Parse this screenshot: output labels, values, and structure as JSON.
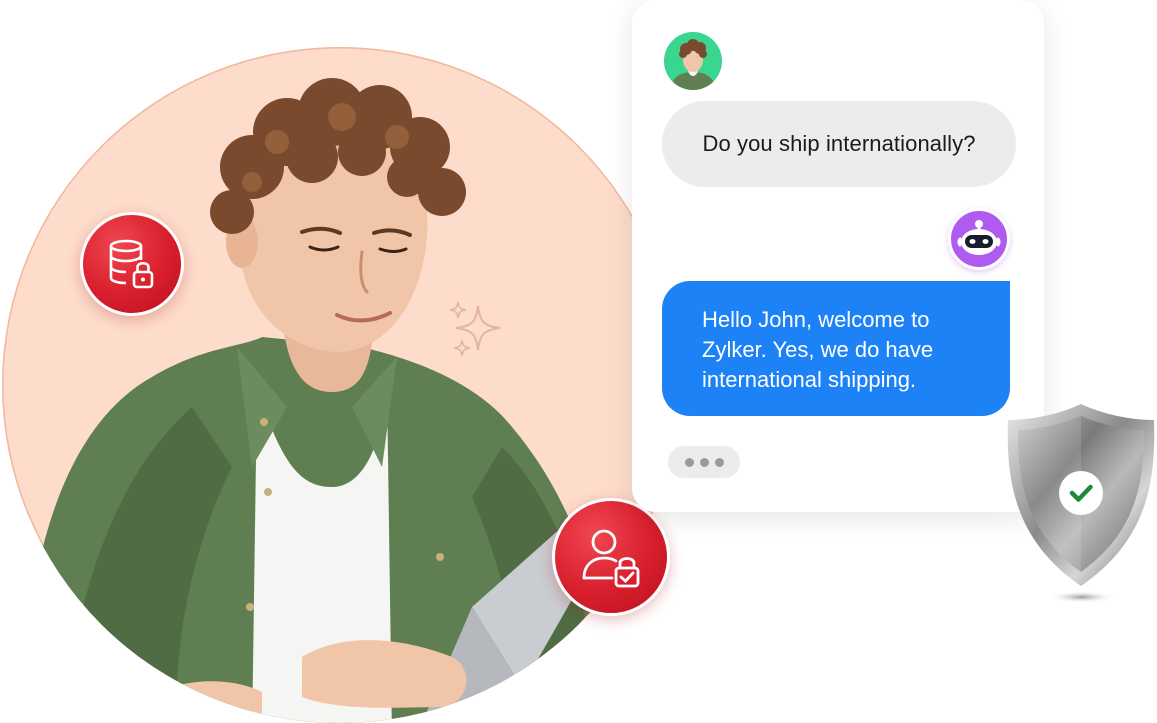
{
  "chat": {
    "user_message": "Do you ship internationally?",
    "bot_message_lines": [
      "Hello John, welcome to",
      "Zylker. Yes, we do have",
      "international shipping."
    ],
    "typing_indicator": "typing-dots"
  },
  "icons": {
    "database_lock": "database-lock-icon",
    "user_lock": "user-lock-icon",
    "shield_check": "shield-check-icon",
    "sparkle": "sparkle-icon",
    "bot": "bot-avatar-icon"
  },
  "colors": {
    "peach_background": "#fddccb",
    "badge_red": "#d81e2c",
    "bot_bubble_blue": "#1d82f5",
    "user_bubble_gray": "#ececec",
    "user_avatar_green": "#3ad58f",
    "bot_avatar_purple": "#b05bf0",
    "check_green": "#1e8a3a"
  }
}
